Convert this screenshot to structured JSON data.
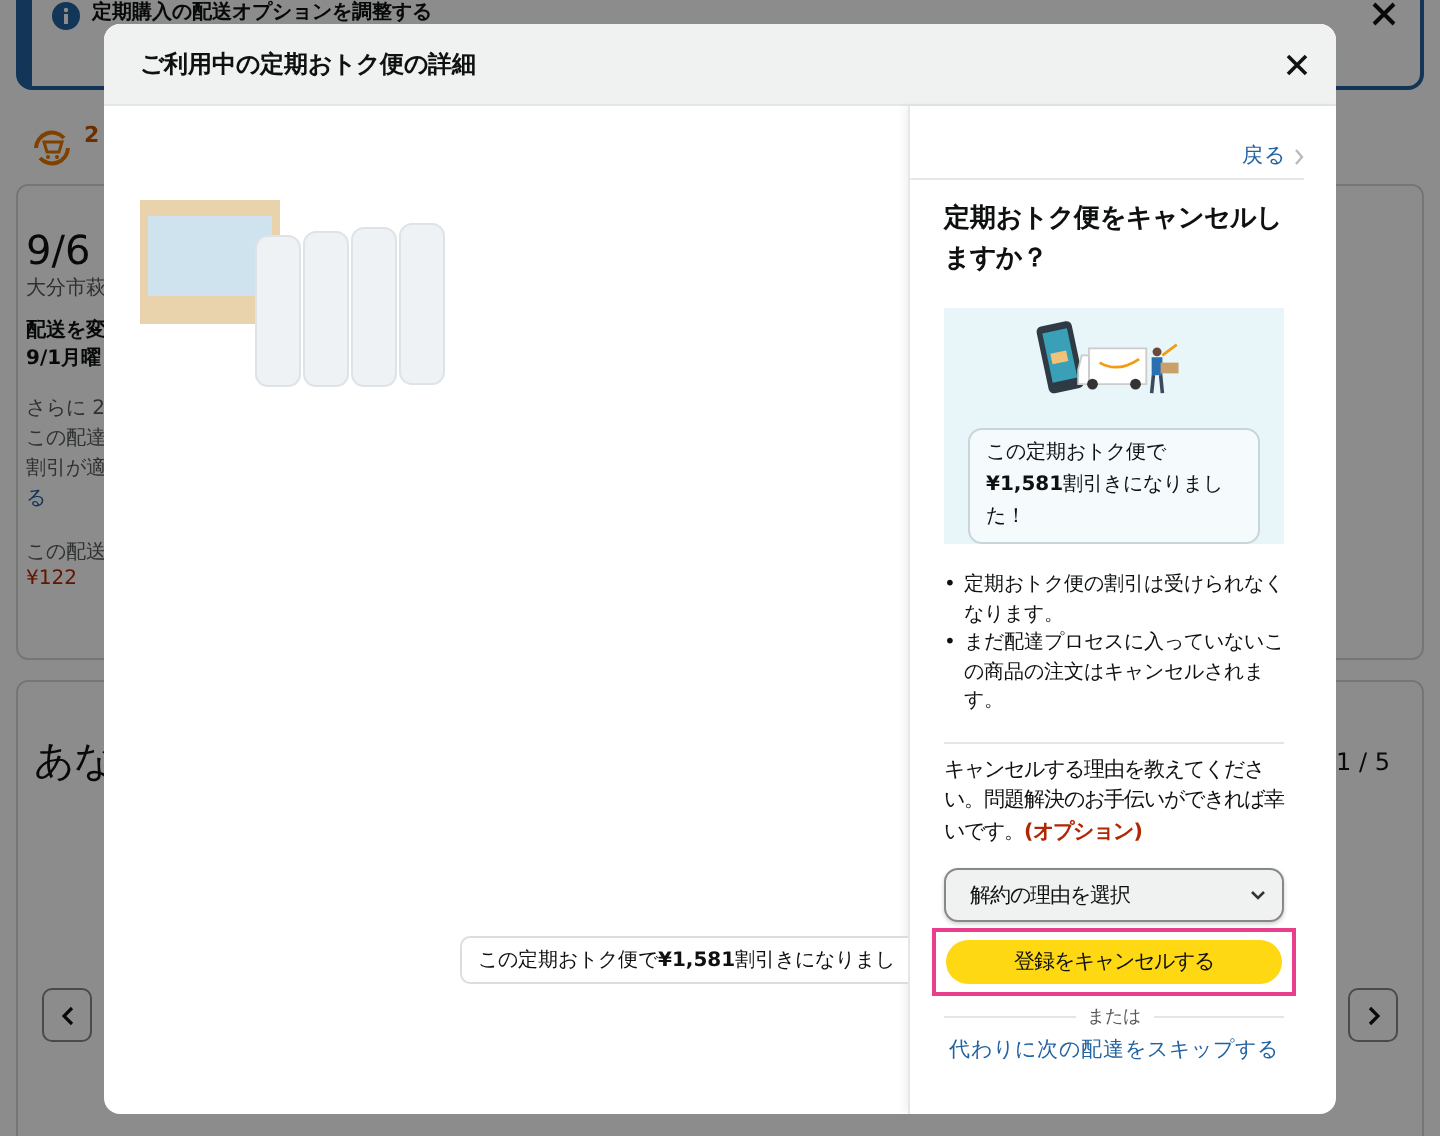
{
  "background": {
    "banner": {
      "title": "定期購入の配送オプションを調整する"
    },
    "subscription_count": "2",
    "delivery": {
      "date": "9/6",
      "address": "大分市萩",
      "change_label": "配送を変",
      "change_date": "9/1月曜",
      "note_lines": [
        "さらに 2",
        "この配達",
        "割引が適"
      ],
      "note_link": "る",
      "fee_label": "この配送",
      "fee": "¥122"
    },
    "section": {
      "title": "あな",
      "page": "1 / 5"
    }
  },
  "modal": {
    "title": "ご利用中の定期おトク便の詳細",
    "savings_tip": "この定期おトク便で**¥1,581**割引きになりまし",
    "panel": {
      "back": "戻る",
      "heading": "定期おトク便をキャンセルしますか？",
      "savings": "この定期おトク便で**¥1,581**割引きになりました！",
      "bullets": [
        {
          "marker": "•",
          "text": "定期おトク便の割引は受けられなくなります。"
        },
        {
          "marker": "•",
          "text": "まだ配達プロセスに入っていないこの商品の注文はキャンセルされます。"
        }
      ],
      "reason_prompt": "キャンセルする理由を教えてください。問題解決のお手伝いができれば幸いです。**(オプション)**",
      "reason_select": {
        "value": "解約の理由を選択"
      },
      "cancel_button": {
        "label": "登録をキャンセルする",
        "highlighted": true
      },
      "or": "または",
      "skip_link": "代わりに次の配達をスキップする"
    }
  }
}
